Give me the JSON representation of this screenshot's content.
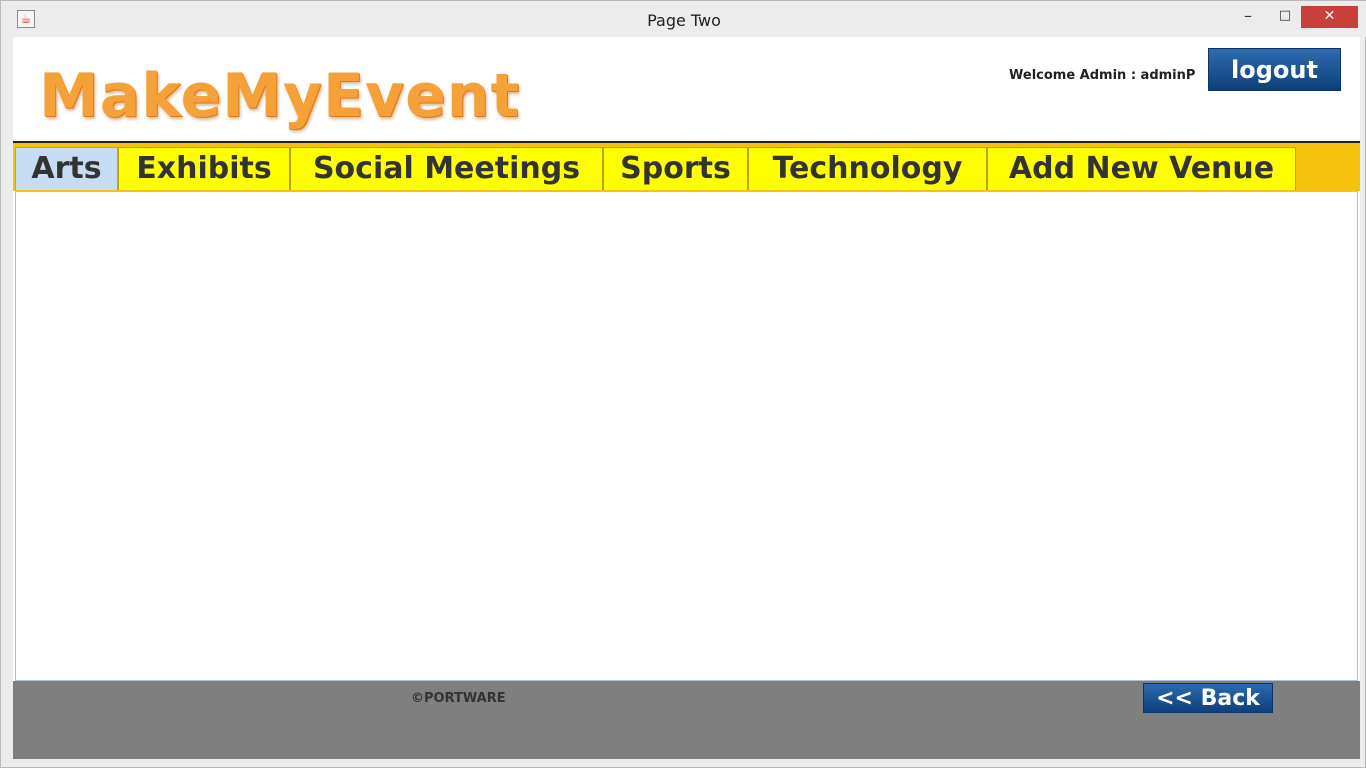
{
  "window": {
    "title": "Page Two",
    "icon": "java-coffee-icon",
    "controls": {
      "minimize": "–",
      "maximize": "□",
      "close": "✕"
    }
  },
  "header": {
    "logo": "MakeMyEvent",
    "welcome": "Welcome Admin : adminP",
    "logout_label": "logout"
  },
  "tabs": [
    {
      "label": "Arts",
      "active": true
    },
    {
      "label": "Exhibits",
      "active": false
    },
    {
      "label": "Social Meetings",
      "active": false
    },
    {
      "label": "Sports",
      "active": false
    },
    {
      "label": "Technology",
      "active": false
    },
    {
      "label": "Add New Venue",
      "active": false
    }
  ],
  "footer": {
    "copyright": "©PORTWARE",
    "back_label": "<< Back"
  },
  "colors": {
    "tab_bar": "#f8c20c",
    "tab": "#ffff00",
    "active_tab": "#c6dcf2",
    "logo": "#f4a13a",
    "button": "#1a4f8f",
    "footer": "#7f7f7f"
  }
}
